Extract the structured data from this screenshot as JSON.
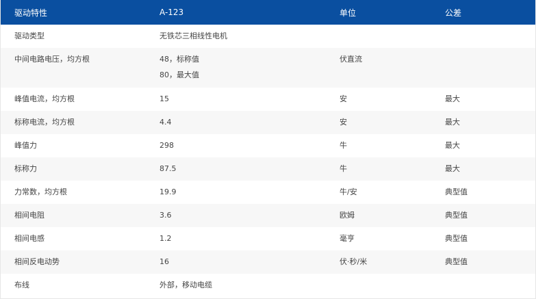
{
  "header": {
    "col1": "驱动特性",
    "col2": "A-123",
    "col3": "单位",
    "col4": "公差"
  },
  "rows": [
    {
      "label": "驱动类型",
      "value": "无铁芯三相线性电机",
      "unit": "",
      "tol": ""
    },
    {
      "label": "中间电路电压，均方根",
      "value": "48，标称值",
      "value2": "80，最大值",
      "unit": "伏直流",
      "tol": ""
    },
    {
      "label": "峰值电流，均方根",
      "value": "15",
      "unit": "安",
      "tol": "最大"
    },
    {
      "label": "标称电流，均方根",
      "value": "4.4",
      "unit": "安",
      "tol": "最大"
    },
    {
      "label": "峰值力",
      "value": "298",
      "unit": "牛",
      "tol": "最大"
    },
    {
      "label": "标称力",
      "value": "87.5",
      "unit": "牛",
      "tol": "最大"
    },
    {
      "label": "力常数，均方根",
      "value": "19.9",
      "unit": "牛/安",
      "tol": "典型值"
    },
    {
      "label": "相间电阻",
      "value": "3.6",
      "unit": "欧姆",
      "tol": "典型值"
    },
    {
      "label": "相间电感",
      "value": "1.2",
      "unit": "毫亨",
      "tol": "典型值"
    },
    {
      "label": "相间反电动势",
      "value": "16",
      "unit": "伏·秒/米",
      "tol": "典型值"
    },
    {
      "label": "布线",
      "value": "外部，移动电缆",
      "unit": "",
      "tol": ""
    }
  ]
}
